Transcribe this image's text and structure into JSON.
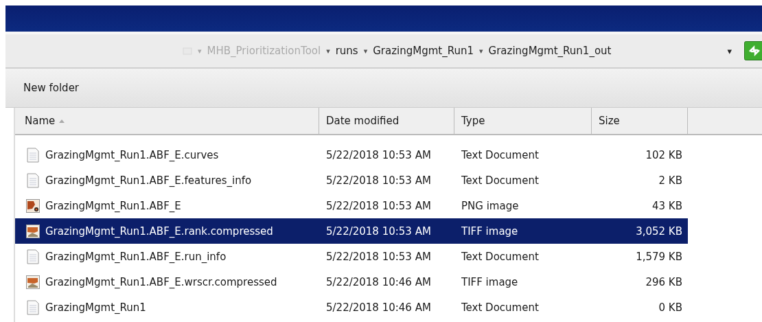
{
  "breadcrumb": [
    {
      "label": "MHB_PrioritizationTool",
      "dim": true
    },
    {
      "label": "runs",
      "dim": false
    },
    {
      "label": "GrazingMgmt_Run1",
      "dim": false
    },
    {
      "label": "GrazingMgmt_Run1_out",
      "dim": false
    }
  ],
  "breadcrumb_separator": "▾",
  "toolbar": {
    "buttons": [
      "New folder"
    ]
  },
  "table": {
    "columns": [
      {
        "label": "Name",
        "sorted": true
      },
      {
        "label": "Date modified",
        "sorted": false
      },
      {
        "label": "Type",
        "sorted": false
      },
      {
        "label": "Size",
        "sorted": false
      }
    ],
    "rows": [
      {
        "kind": "text",
        "name": "GrazingMgmt_Run1.ABF_E.curves",
        "date": "5/22/2018 10:53 AM",
        "type": "Text Document",
        "size": "102 KB",
        "selected": false
      },
      {
        "kind": "text",
        "name": "GrazingMgmt_Run1.ABF_E.features_info",
        "date": "5/22/2018 10:53 AM",
        "type": "Text Document",
        "size": "2 KB",
        "selected": false
      },
      {
        "kind": "png",
        "name": "GrazingMgmt_Run1.ABF_E",
        "date": "5/22/2018 10:53 AM",
        "type": "PNG image",
        "size": "43 KB",
        "selected": false
      },
      {
        "kind": "tiff",
        "name": "GrazingMgmt_Run1.ABF_E.rank.compressed",
        "date": "5/22/2018 10:53 AM",
        "type": "TIFF image",
        "size": "3,052 KB",
        "selected": true
      },
      {
        "kind": "text",
        "name": "GrazingMgmt_Run1.ABF_E.run_info",
        "date": "5/22/2018 10:53 AM",
        "type": "Text Document",
        "size": "1,579 KB",
        "selected": false
      },
      {
        "kind": "tiff",
        "name": "GrazingMgmt_Run1.ABF_E.wrscr.compressed",
        "date": "5/22/2018 10:46 AM",
        "type": "TIFF image",
        "size": "296 KB",
        "selected": false
      },
      {
        "kind": "text",
        "name": "GrazingMgmt_Run1",
        "date": "5/22/2018 10:46 AM",
        "type": "Text Document",
        "size": "0 KB",
        "selected": false
      }
    ]
  }
}
